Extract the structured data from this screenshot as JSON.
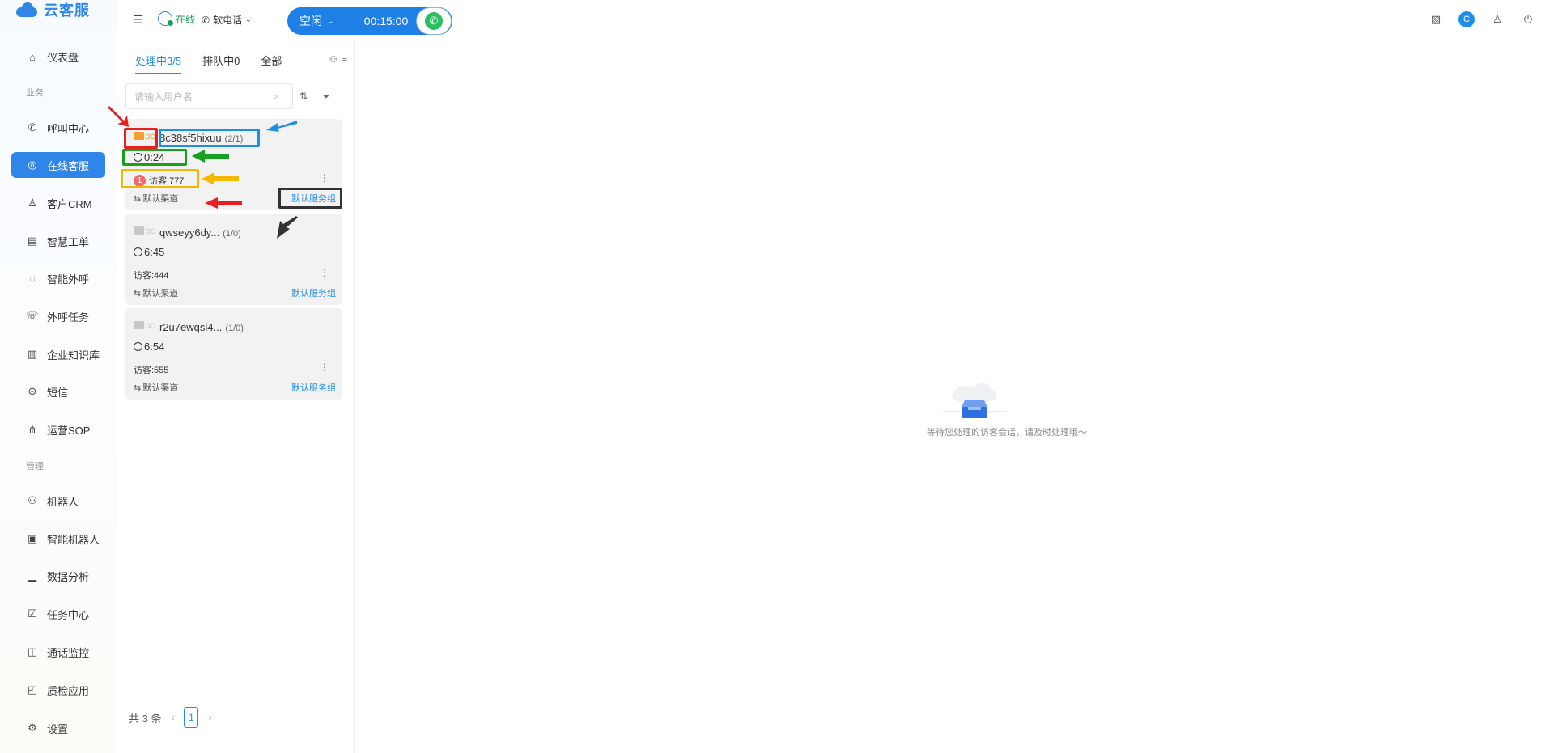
{
  "app": {
    "title": "云客服"
  },
  "sidebar": {
    "items": [
      {
        "label": "仪表盘",
        "icon": "home-icon"
      },
      {
        "section": "业务"
      },
      {
        "label": "呼叫中心",
        "icon": "phone-icon"
      },
      {
        "label": "在线客服",
        "icon": "headset-icon",
        "active": true
      },
      {
        "label": "客户CRM",
        "icon": "user-icon"
      },
      {
        "label": "智慧工单",
        "icon": "document-icon"
      },
      {
        "label": "智能外呼",
        "icon": "whatsapp-icon"
      },
      {
        "label": "外呼任务",
        "icon": "phone-forward-icon"
      },
      {
        "label": "企业知识库",
        "icon": "book-icon"
      },
      {
        "label": "短信",
        "icon": "message-icon"
      },
      {
        "label": "运营SOP",
        "icon": "share-nodes-icon"
      },
      {
        "section": "管理"
      },
      {
        "label": "机器人",
        "icon": "robot-icon"
      },
      {
        "label": "智能机器人",
        "icon": "smart-robot-icon"
      },
      {
        "label": "数据分析",
        "icon": "bar-chart-icon"
      },
      {
        "label": "任务中心",
        "icon": "task-icon"
      },
      {
        "label": "通话监控",
        "icon": "monitor-icon"
      },
      {
        "label": "质检应用",
        "icon": "quality-icon"
      },
      {
        "label": "设置",
        "icon": "gear-icon"
      }
    ]
  },
  "topbar": {
    "online_label": "在线",
    "phone_mode_label": "软电话",
    "call_status": "空闲",
    "call_timer": "00:15:00",
    "avatar_letter": "C"
  },
  "panel": {
    "tabs": [
      {
        "label": "处理中3/5",
        "active": true
      },
      {
        "label": "排队中0"
      },
      {
        "label": "全部"
      }
    ],
    "search_placeholder": "请输入用户名",
    "sessions": [
      {
        "channel": "pc",
        "name": "8c38sf5hixuu",
        "count": "(2/1)",
        "duration": "0:24",
        "badge": "1",
        "visitor": "访客:777",
        "source": "默认渠道",
        "group": "默认服务组",
        "highlight": true
      },
      {
        "channel": "pc",
        "name": "qwseyy6dy...",
        "count": "(1/0)",
        "duration": "6:45",
        "visitor": "访客:444",
        "source": "默认渠道",
        "group": "默认服务组"
      },
      {
        "channel": "pc",
        "name": "r2u7ewqsl4...",
        "count": "(1/0)",
        "duration": "6:54",
        "visitor": "访客:555",
        "source": "默认渠道",
        "group": "默认服务组"
      }
    ],
    "pager": {
      "total": "共 3 条",
      "current": "1"
    }
  },
  "main": {
    "empty_text": "等待您处理的访客会话，请及时处理哦～"
  },
  "colors": {
    "accent": "#1e8fe8",
    "online": "#19a05b",
    "dial": "#29c05f"
  }
}
